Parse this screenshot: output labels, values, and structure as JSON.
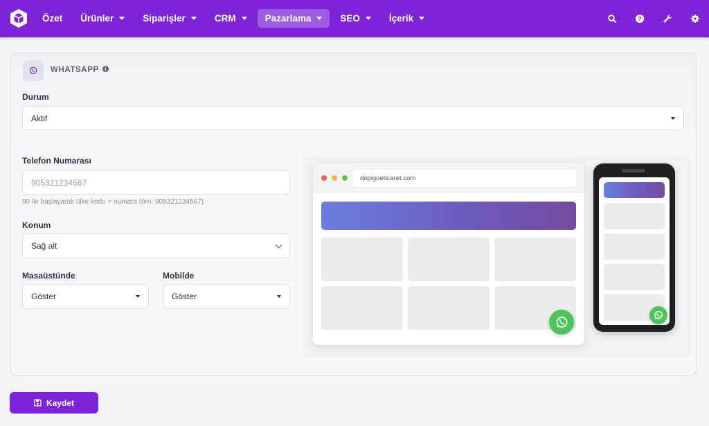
{
  "navbar": {
    "logo_icon": "cube-logo-icon",
    "items": [
      {
        "label": "Özet",
        "has_caret": false,
        "active": false
      },
      {
        "label": "Ürünler",
        "has_caret": true,
        "active": false
      },
      {
        "label": "Siparişler",
        "has_caret": true,
        "active": false
      },
      {
        "label": "CRM",
        "has_caret": true,
        "active": false
      },
      {
        "label": "Pazarlama",
        "has_caret": true,
        "active": true
      },
      {
        "label": "SEO",
        "has_caret": true,
        "active": false
      },
      {
        "label": "İçerik",
        "has_caret": true,
        "active": false
      }
    ],
    "right_icons": [
      "search-icon",
      "help-icon",
      "wrench-icon",
      "gear-icon"
    ]
  },
  "card": {
    "icon": "whatsapp-icon",
    "title": "WHATSAPP",
    "status": {
      "label": "Durum",
      "value": "Aktif"
    },
    "phone": {
      "label": "Telefon Numarası",
      "placeholder": "905321234567",
      "value": "",
      "help": "90 ile başlayarak ülke kodu + numara (örn: 905321234567)"
    },
    "position": {
      "label": "Konum",
      "value": "Sağ alt"
    },
    "desktop": {
      "label": "Masaüstünde",
      "value": "Göster"
    },
    "mobile": {
      "label": "Mobilde",
      "value": "Göster"
    },
    "preview": {
      "url": "dopigoeticaret.com"
    }
  },
  "save_button": {
    "label": "Kaydet",
    "icon": "floppy-disk-icon"
  },
  "colors": {
    "brand": "#7d24d9",
    "whatsapp": "#4fc45c"
  }
}
